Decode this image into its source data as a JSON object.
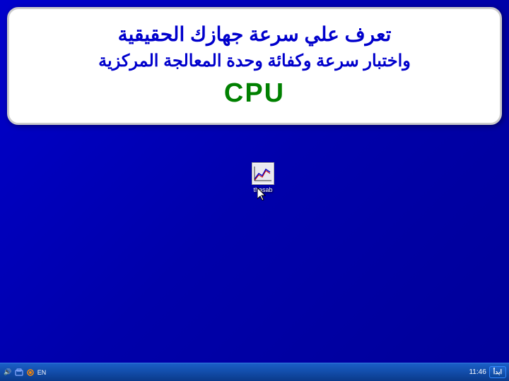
{
  "title_card": {
    "line1": "تعرف علي سرعة جهازك الحقيقية",
    "line2": "واختبار سرعة وكفائة وحدة المعالجة المركزية",
    "cpu_label": "CPU"
  },
  "desktop": {
    "icon_label": "thasab"
  },
  "taskbar": {
    "start_button": "ابدأ",
    "clock": "11:46"
  }
}
